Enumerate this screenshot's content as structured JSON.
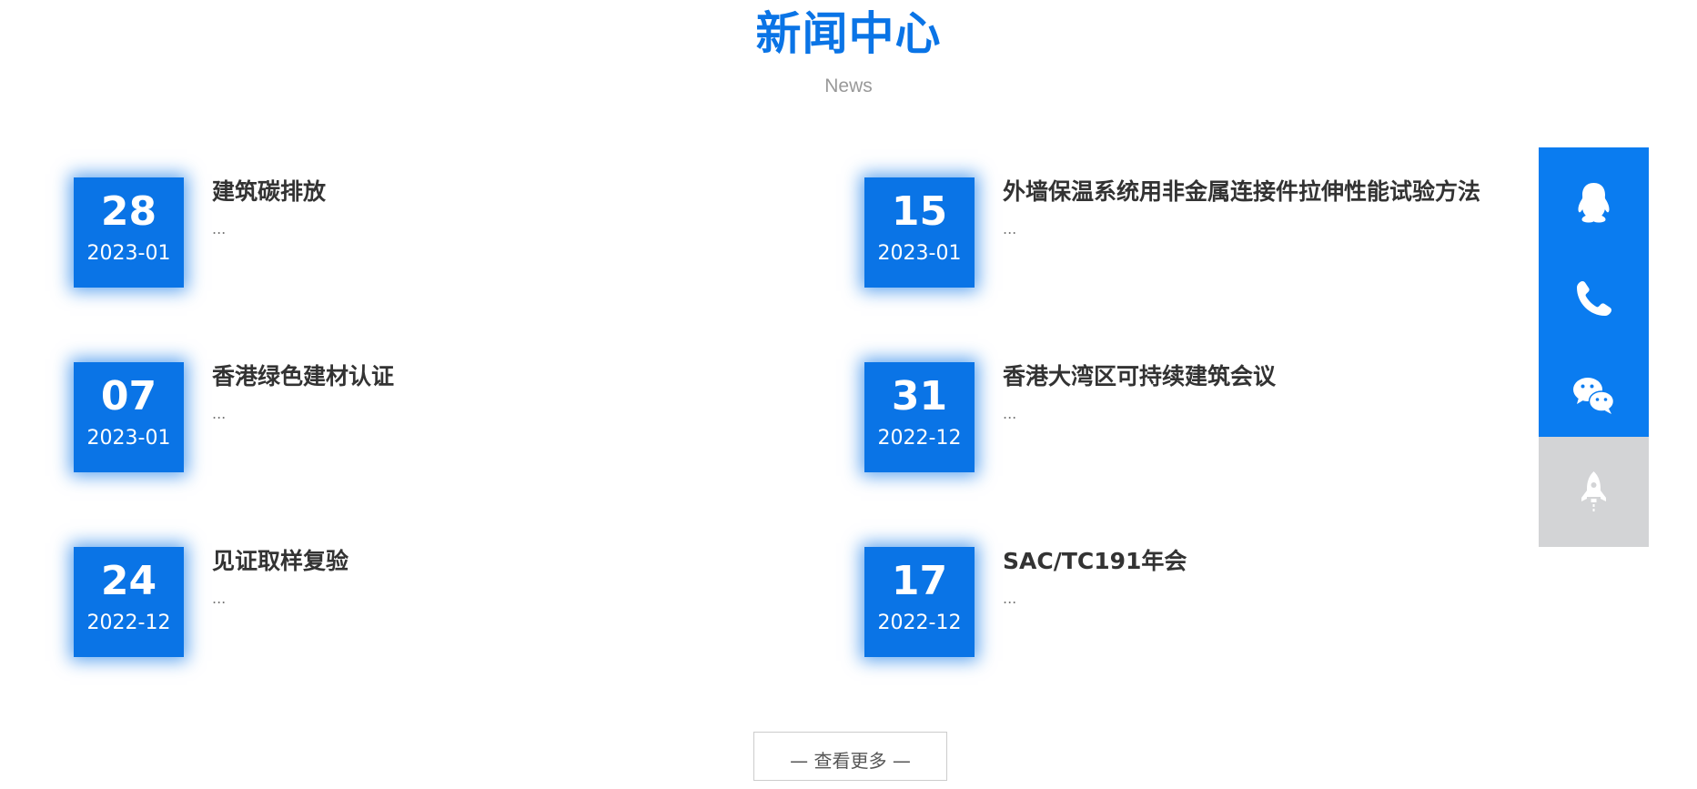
{
  "section": {
    "title": "新闻中心",
    "subtitle": "News"
  },
  "news": [
    {
      "day": "28",
      "ym": "2023-01",
      "title": "建筑碳排放",
      "excerpt": "..."
    },
    {
      "day": "15",
      "ym": "2023-01",
      "title": "外墙保温系统用非金属连接件拉伸性能试验方法",
      "excerpt": "..."
    },
    {
      "day": "07",
      "ym": "2023-01",
      "title": "香港绿色建材认证",
      "excerpt": "..."
    },
    {
      "day": "31",
      "ym": "2022-12",
      "title": "香港大湾区可持续建筑会议",
      "excerpt": "..."
    },
    {
      "day": "24",
      "ym": "2022-12",
      "title": "见证取样复验",
      "excerpt": "..."
    },
    {
      "day": "17",
      "ym": "2022-12",
      "title": "SAC/TC191年会",
      "excerpt": "..."
    }
  ],
  "more_button": {
    "label": "— 查看更多 —"
  },
  "float_bar": {
    "buttons": [
      {
        "icon": "qq-icon",
        "color": "#0a7cf0"
      },
      {
        "icon": "phone-icon",
        "color": "#0a7cf0"
      },
      {
        "icon": "wechat-icon",
        "color": "#0a7cf0"
      },
      {
        "icon": "rocket-icon",
        "color": "#d3d4d6"
      }
    ]
  },
  "colors": {
    "accent": "#0a74e6",
    "title_text": "#333333",
    "subtitle_text": "#999999"
  }
}
